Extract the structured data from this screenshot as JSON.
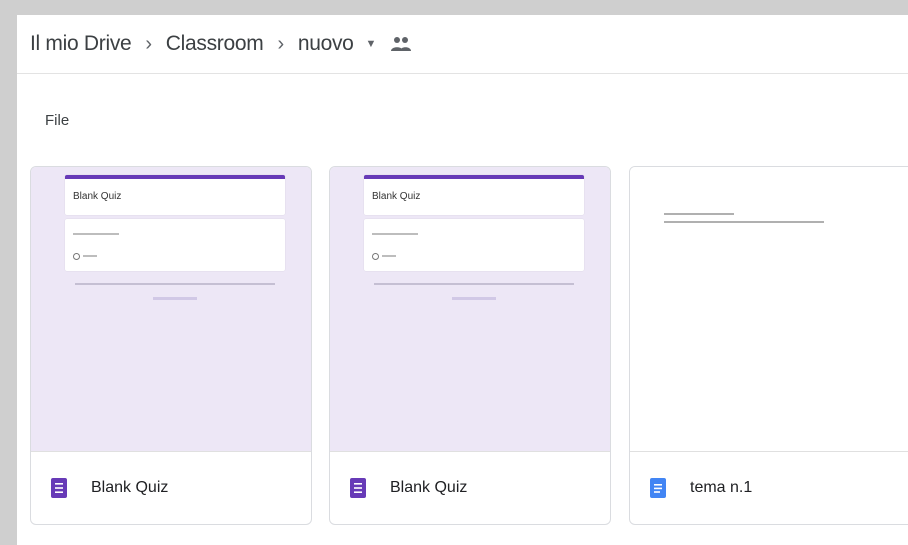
{
  "breadcrumb": {
    "items": [
      "Il mio Drive",
      "Classroom",
      "nuovo"
    ],
    "separator": "›",
    "dropdown_icon": "caret-down-icon",
    "shared_icon": "people-icon"
  },
  "section": {
    "title": "File"
  },
  "files": [
    {
      "name": "Blank Quiz",
      "type": "form",
      "icon": "google-forms-icon",
      "preview_title": "Blank Quiz",
      "icon_color": "#673ab7"
    },
    {
      "name": "Blank Quiz",
      "type": "form",
      "icon": "google-forms-icon",
      "preview_title": "Blank Quiz",
      "icon_color": "#673ab7"
    },
    {
      "name": "tema n.1",
      "type": "doc",
      "icon": "google-docs-icon",
      "icon_color": "#4285f4"
    }
  ]
}
